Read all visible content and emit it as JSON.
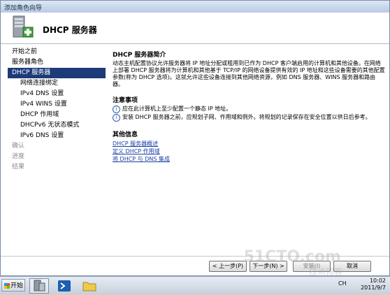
{
  "window": {
    "title": "添加角色向导"
  },
  "header": {
    "title": "DHCP 服务器"
  },
  "nav": {
    "items": [
      {
        "label": "开始之前",
        "level": 0,
        "state": "normal"
      },
      {
        "label": "服务器角色",
        "level": 0,
        "state": "normal"
      },
      {
        "label": "DHCP 服务器",
        "level": 0,
        "state": "active"
      },
      {
        "label": "网络连接绑定",
        "level": 1,
        "state": "normal"
      },
      {
        "label": "IPv4 DNS 设置",
        "level": 1,
        "state": "normal"
      },
      {
        "label": "IPv4 WINS 设置",
        "level": 1,
        "state": "normal"
      },
      {
        "label": "DHCP 作用域",
        "level": 1,
        "state": "normal"
      },
      {
        "label": "DHCPv6 无状态模式",
        "level": 1,
        "state": "normal"
      },
      {
        "label": "IPv6 DNS 设置",
        "level": 1,
        "state": "normal"
      },
      {
        "label": "确认",
        "level": 0,
        "state": "disabled"
      },
      {
        "label": "进度",
        "level": 0,
        "state": "disabled"
      },
      {
        "label": "结果",
        "level": 0,
        "state": "disabled"
      }
    ]
  },
  "content": {
    "intro_heading": "DHCP 服务器简介",
    "intro_text": "动态主机配置协议允许服务器将 IP 地址分配或租用到已作为 DHCP 客户端启用的计算机和其他设备。在网络上部署 DHCP 服务器将为计算机和其他基于 TCP/IP 的网络设备提供有效的 IP 地址和这些设备需要的其他配置参数(称为 DHCP 选项)。这就允许这些设备连接到其他网络资源，例如 DNS 服务器、WINS 服务器和路由器。",
    "notes_heading": "注意事项",
    "notes": [
      "应在此计算机上至少配置一个静态 IP 地址。",
      "安装 DHCP 服务器之前，应规划子网、作用域和例外。将规划的记录保存在安全位置以供日后参考。"
    ],
    "more_heading": "其他信息",
    "links": [
      "DHCP 服务器概述",
      "定义 DHCP 作用域",
      "将 DHCP 与 DNS 集成"
    ]
  },
  "buttons": {
    "prev": "< 上一步(P)",
    "next": "下一步(N) >",
    "install": "安装(I)",
    "cancel": "取消"
  },
  "taskbar": {
    "start_label": "开始",
    "lang": "CH",
    "time": "10:02",
    "date": "2011/9/7"
  },
  "watermark": {
    "site": "51CTO.com",
    "sub": "技术博客"
  }
}
